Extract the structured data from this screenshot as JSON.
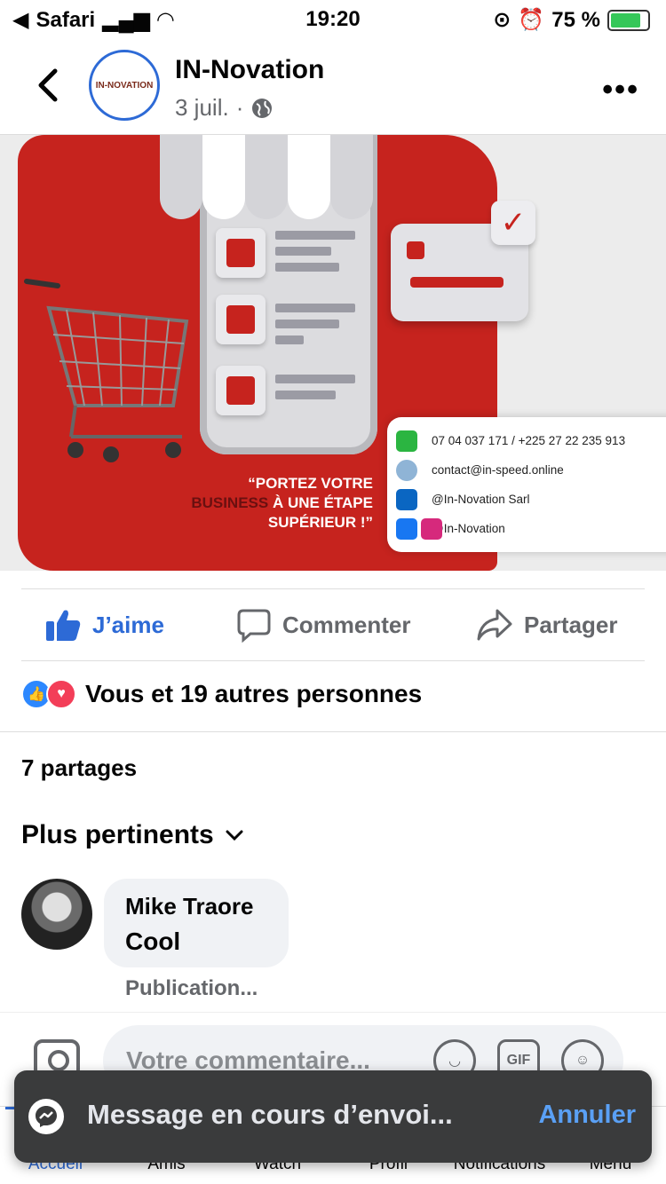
{
  "status_bar": {
    "carrier": "Safari",
    "time": "19:20",
    "battery": "75 %"
  },
  "header": {
    "page_name": "IN-Novation",
    "date": "3 juil.",
    "separator": "·",
    "avatar_text": "IN-NOVATION"
  },
  "post_image": {
    "slogan_1": "“PORTEZ VOTRE",
    "slogan_biz": "BUSINESS",
    "slogan_2": " À UNE ÉTAPE",
    "slogan_3": "SUPÉRIEUR !”",
    "phone": "07 04 037 171 / +225 27 22 235 913",
    "email": "contact@in-speed.online",
    "linkedin": "@In-Novation Sarl",
    "social": "@In-Novation",
    "colors": {
      "brand_red": "#c6231e"
    }
  },
  "actions": {
    "like": "J’aime",
    "comment": "Commenter",
    "share": "Partager"
  },
  "reactions": {
    "summary": "Vous et 19 autres personnes"
  },
  "shares_count": "7 partages",
  "sort": {
    "label": "Plus pertinents"
  },
  "comment": {
    "author": "Mike Traore",
    "text": "Cool",
    "meta": "Publication..."
  },
  "composer": {
    "placeholder": "Votre commentaire...",
    "gif": "GIF"
  },
  "tabbar": {
    "tabs": [
      "Accueil",
      "Amis",
      "Watch",
      "Profil",
      "Notifications",
      "Menu"
    ],
    "active": "Accueil"
  },
  "toast": {
    "message": "Message en cours d’envoi...",
    "cancel": "Annuler"
  },
  "theme": {
    "accent": "#2d6ad6",
    "text_secondary": "#65676b",
    "toast_bg": "#3a3b3c"
  }
}
